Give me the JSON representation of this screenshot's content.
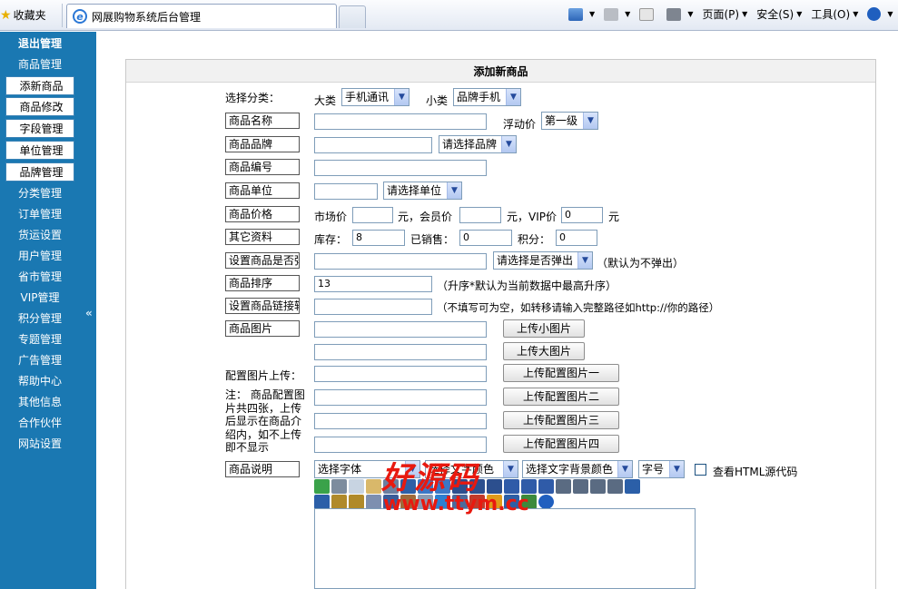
{
  "browser": {
    "favorites_label": "收藏夹",
    "tab_title": "网展购物系统后台管理",
    "commands": [
      "页面(P)",
      "安全(S)",
      "工具(O)"
    ]
  },
  "sidebar": {
    "items": [
      {
        "label": "退出管理",
        "style": "head"
      },
      {
        "label": "商品管理",
        "style": "link"
      },
      {
        "label": "添新商品",
        "style": "box"
      },
      {
        "label": "商品修改",
        "style": "box"
      },
      {
        "label": "字段管理",
        "style": "box"
      },
      {
        "label": "单位管理",
        "style": "box"
      },
      {
        "label": "品牌管理",
        "style": "box"
      },
      {
        "label": "分类管理",
        "style": "link"
      },
      {
        "label": "订单管理",
        "style": "link"
      },
      {
        "label": "货运设置",
        "style": "link"
      },
      {
        "label": "用户管理",
        "style": "link"
      },
      {
        "label": "省市管理",
        "style": "link"
      },
      {
        "label": "VIP管理",
        "style": "link"
      },
      {
        "label": "积分管理",
        "style": "link"
      },
      {
        "label": "专题管理",
        "style": "link"
      },
      {
        "label": "广告管理",
        "style": "link"
      },
      {
        "label": "帮助中心",
        "style": "link"
      },
      {
        "label": "其他信息",
        "style": "link"
      },
      {
        "label": "合作伙伴",
        "style": "link"
      },
      {
        "label": "网站设置",
        "style": "link"
      }
    ],
    "collapse_glyph": "«"
  },
  "panel": {
    "title": "添加新商品"
  },
  "form": {
    "category": {
      "label": "选择分类：",
      "big_label": "大类",
      "big_value": "手机通讯",
      "small_label": "小类",
      "small_value": "品牌手机"
    },
    "name": {
      "label": "商品名称",
      "value": "",
      "float_label": "浮动价",
      "float_value": "第一级"
    },
    "brand": {
      "label": "商品品牌",
      "value": "",
      "select": "请选择品牌"
    },
    "code": {
      "label": "商品编号",
      "value": ""
    },
    "unit": {
      "label": "商品单位",
      "value": "",
      "select": "请选择单位"
    },
    "price": {
      "label": "商品价格",
      "market_label": "市场价",
      "market_value": "",
      "unit1": "元，会员价",
      "member_value": "",
      "unit2": "元，VIP价",
      "vip_value": "0",
      "unit3": "元"
    },
    "other": {
      "label": "其它资料",
      "stock_label": "库存：",
      "stock_value": "8",
      "sold_label": "已销售：",
      "sold_value": "0",
      "points_label": "积分：",
      "points_value": "0"
    },
    "popup": {
      "label": "设置商品是否弹出",
      "value": "",
      "select": "请选择是否弹出",
      "note": "（默认为不弹出）"
    },
    "sort": {
      "label": "商品排序",
      "value": "13",
      "note": "（升序*默认为当前数据中最高升序）"
    },
    "link": {
      "label": "设置商品链接转向",
      "value": "",
      "note": "（不填写可为空，如转移请输入完整路径如http://你的路径）"
    },
    "image": {
      "label": "商品图片",
      "small_button": "上传小图片",
      "big_button": "上传大图片"
    },
    "extra_images": {
      "label": "配置图片上传：",
      "note_lines": [
        "注： 商品配置图",
        "片共四张，上传",
        "后显示在商品介",
        "绍内，如不上传",
        "即不显示"
      ],
      "buttons": [
        "上传配置图片一",
        "上传配置图片二",
        "上传配置图片三",
        "上传配置图片四"
      ]
    },
    "description": {
      "label": "商品说明",
      "font_select": "选择字体",
      "color_select": "选择文字颜色",
      "bg_select": "选择文字背景颜色",
      "size_select": "字号",
      "source_label": "查看HTML源代码"
    }
  },
  "watermark": {
    "line1": "好源码",
    "line2": "www.ttym.cc"
  },
  "colors": {
    "sidebar_bg": "#1a78b2",
    "accent": "#2b78d6",
    "watermark": "#e8190f"
  },
  "icons": [
    "star-icon",
    "ie-logo-icon",
    "home-icon",
    "rss-icon",
    "mail-icon",
    "print-icon",
    "help-icon",
    "collapse-icon"
  ]
}
